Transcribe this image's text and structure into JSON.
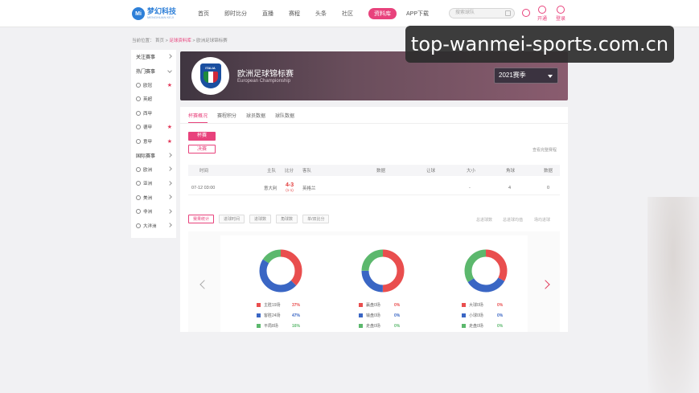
{
  "header": {
    "logo_cn": "梦幻科技",
    "logo_en": "MENGHUAN KEJI",
    "logo_badge": "Mi",
    "nav": [
      "首页",
      "即时比分",
      "直播",
      "赛程",
      "头条",
      "社区",
      "资料库",
      "APP下载"
    ],
    "active_nav": "资料库",
    "search_placeholder": "搜索球队",
    "open_vip": "开通",
    "login": "登录"
  },
  "watermark": "top-wanmei-sports.com.cn",
  "breadcrumb": {
    "prefix": "当前位置：",
    "home": "首页",
    "db": "足球资料库",
    "current": "欧洲足球锦标赛"
  },
  "sidebar": {
    "items": [
      {
        "label": "关注赛事",
        "type": "head"
      },
      {
        "label": "热门赛事",
        "type": "head-open"
      },
      {
        "label": "欧冠",
        "type": "star"
      },
      {
        "label": "英超",
        "type": "plain"
      },
      {
        "label": "西甲",
        "type": "plain"
      },
      {
        "label": "德甲",
        "type": "star"
      },
      {
        "label": "意甲",
        "type": "star"
      },
      {
        "label": "国际赛事",
        "type": "head"
      },
      {
        "label": "欧洲",
        "type": "region"
      },
      {
        "label": "亚洲",
        "type": "region"
      },
      {
        "label": "美洲",
        "type": "region"
      },
      {
        "label": "非洲",
        "type": "region"
      },
      {
        "label": "大洋洲",
        "type": "region"
      }
    ]
  },
  "league": {
    "badge_text": "ITALIA",
    "title_cn": "欧洲足球锦标赛",
    "title_en": "European Championship",
    "season": "2021赛季"
  },
  "tabs": [
    "杯赛概况",
    "赛程积分",
    "球员数据",
    "球队数据"
  ],
  "stages": {
    "on": "杯赛",
    "off": "决赛"
  },
  "more_link": "查看完整赛程",
  "table": {
    "headers": [
      "时间",
      "主队",
      "比分",
      "客队",
      "数据",
      "让球",
      "大小",
      "角球",
      "数据"
    ],
    "rows": [
      {
        "time": "07-12 03:00",
        "home": "意大利",
        "score": "4-3",
        "half": "(1-1)",
        "away": "英格兰",
        "handicap": "-",
        "ou": "-",
        "corner": "4",
        "data": "0"
      }
    ]
  },
  "stat_tabs": [
    "赛果统计",
    "进球时间",
    "进球数",
    "角球数",
    "单/双比分"
  ],
  "stat_right": [
    "总进球数",
    "总进球均值",
    "场均进球"
  ],
  "donuts": [
    {
      "segments": [
        {
          "label": "主胜19场",
          "pct": "37%",
          "value": 37,
          "color": "#e94e4e"
        },
        {
          "label": "客胜24场",
          "pct": "47%",
          "value": 47,
          "color": "#3a66c4"
        },
        {
          "label": "平局8场",
          "pct": "16%",
          "value": 16,
          "color": "#5cb86d"
        }
      ]
    },
    {
      "segments": [
        {
          "label": "赢盘0场",
          "pct": "0%",
          "value": 50,
          "color": "#e94e4e"
        },
        {
          "label": "输盘0场",
          "pct": "0%",
          "value": 25,
          "color": "#3a66c4"
        },
        {
          "label": "走盘0场",
          "pct": "0%",
          "value": 25,
          "color": "#5cb86d"
        }
      ]
    },
    {
      "segments": [
        {
          "label": "大球0场",
          "pct": "0%",
          "value": 33,
          "color": "#e94e4e"
        },
        {
          "label": "小球0场",
          "pct": "0%",
          "value": 33,
          "color": "#3a66c4"
        },
        {
          "label": "走盘0场",
          "pct": "0%",
          "value": 34,
          "color": "#5cb86d"
        }
      ]
    }
  ]
}
